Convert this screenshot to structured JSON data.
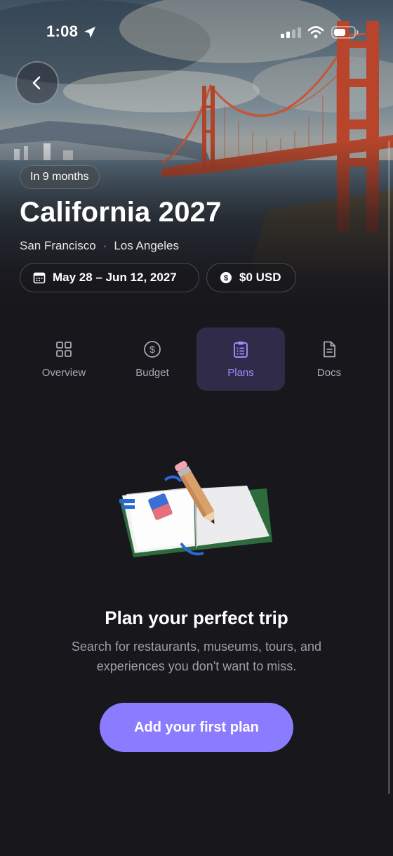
{
  "status_bar": {
    "time": "1:08"
  },
  "trip": {
    "countdown": "In 9 months",
    "title": "California 2027",
    "cities": [
      "San Francisco",
      "Los Angeles"
    ],
    "city_separator": "·",
    "dates": "May 28 – Jun 12, 2027",
    "budget": "$0 USD"
  },
  "tabs": [
    {
      "label": "Overview",
      "icon": "grid-icon",
      "active": false
    },
    {
      "label": "Budget",
      "icon": "dollar-circle-icon",
      "active": false
    },
    {
      "label": "Plans",
      "icon": "clipboard-icon",
      "active": true
    },
    {
      "label": "Docs",
      "icon": "document-icon",
      "active": false
    }
  ],
  "empty_state": {
    "title": "Plan your perfect trip",
    "body": "Search for restaurants, museums, tours, and experiences you don't want to miss.",
    "cta": "Add your first plan"
  },
  "colors": {
    "accent": "#8b7bff",
    "background": "#18171c",
    "active_tab_bg": "#302b48"
  }
}
